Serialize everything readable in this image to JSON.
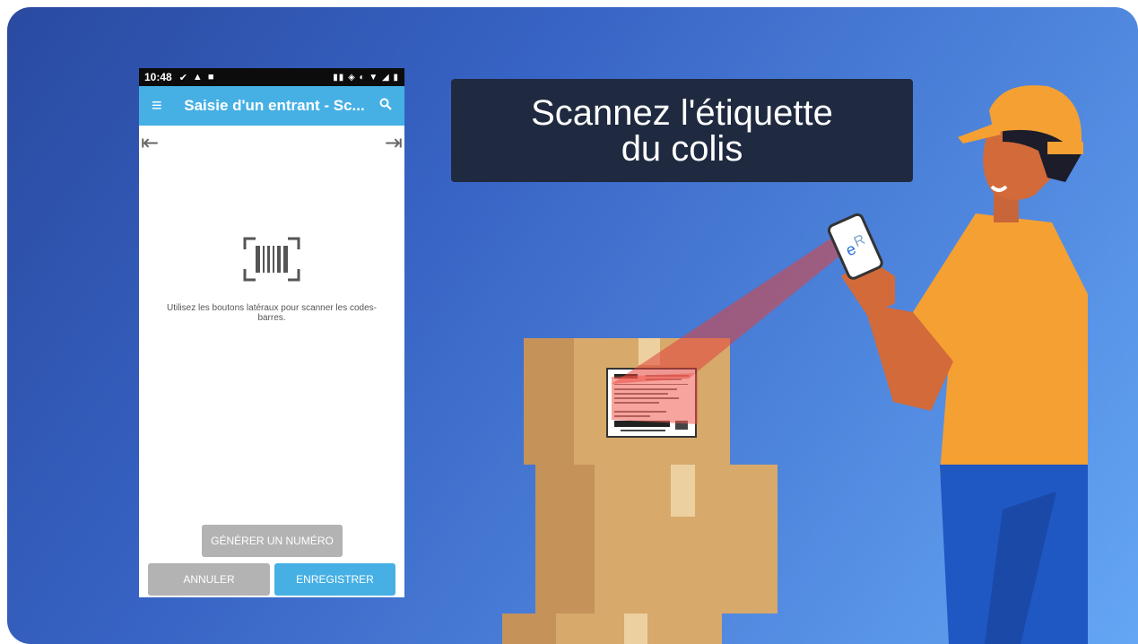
{
  "phone": {
    "status_time": "10:48",
    "app_title": "Saisie d'un entrant - Sc...",
    "hint": "Utilisez les boutons latéraux pour scanner les codes-barres.",
    "buttons": {
      "generate": "GÉNÉRER UN NUMÉRO",
      "cancel": "ANNULER",
      "save": "ENREGISTRER"
    }
  },
  "banner": {
    "line1": "Scannez l'étiquette",
    "line2": "du colis"
  },
  "colors": {
    "appbar": "#46b0e5",
    "button_grey": "#b3b3b3",
    "banner_bg": "#1f2a40"
  }
}
